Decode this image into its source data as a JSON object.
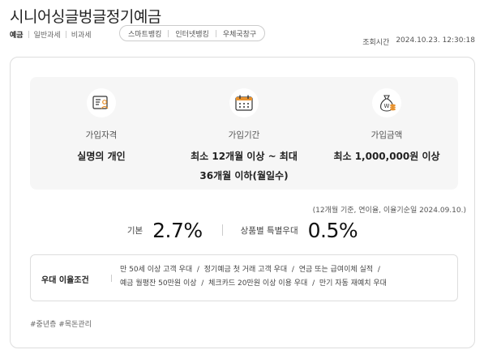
{
  "product": {
    "title": "시니어싱글벙글정기예금"
  },
  "tags": [
    "예금",
    "일반과세",
    "비과세"
  ],
  "channels": [
    "스마트뱅킹",
    "인터넷뱅킹",
    "우체국창구"
  ],
  "inquiry": {
    "label": "조회시간",
    "time": "2024.10.23. 12:30:18"
  },
  "summary": {
    "eligibility": {
      "icon": "person-document-icon",
      "label": "가입자격",
      "value": "실명의 개인"
    },
    "period": {
      "icon": "calendar-icon",
      "label": "가입기간",
      "value_line1": "최소 12개월 이상 ~ 최대",
      "value_line2": "36개월 이하(월일수)"
    },
    "amount": {
      "icon": "money-bag-icon",
      "label": "가입금액",
      "value": "최소 1,000,000원 이상"
    }
  },
  "rate_note": "(12개월 기준, 연이율, 이율기순일 2024.09.10.)",
  "rates": {
    "base": {
      "label": "기본",
      "value": "2.7%"
    },
    "bonus": {
      "label": "상품별 특별우대",
      "value": "0.5%"
    }
  },
  "preferential": {
    "label": "우대 이율조건",
    "line1": [
      "만 50세 이상 고객 우대",
      "정기예금 첫 거래 고객 우대",
      "연금 또는 급여이체 실적"
    ],
    "line2": [
      "예금 월평잔 50만원 이상",
      "체크카드 20만원 이상 이용 우대",
      "만기 자동 재예치 우대"
    ],
    "separator": "/"
  },
  "hashtags": "#중년층 #목돈관리",
  "colors": {
    "icon_accent": "#e8922e",
    "summary_bg": "#f6f6f6",
    "border": "#dddddd"
  }
}
